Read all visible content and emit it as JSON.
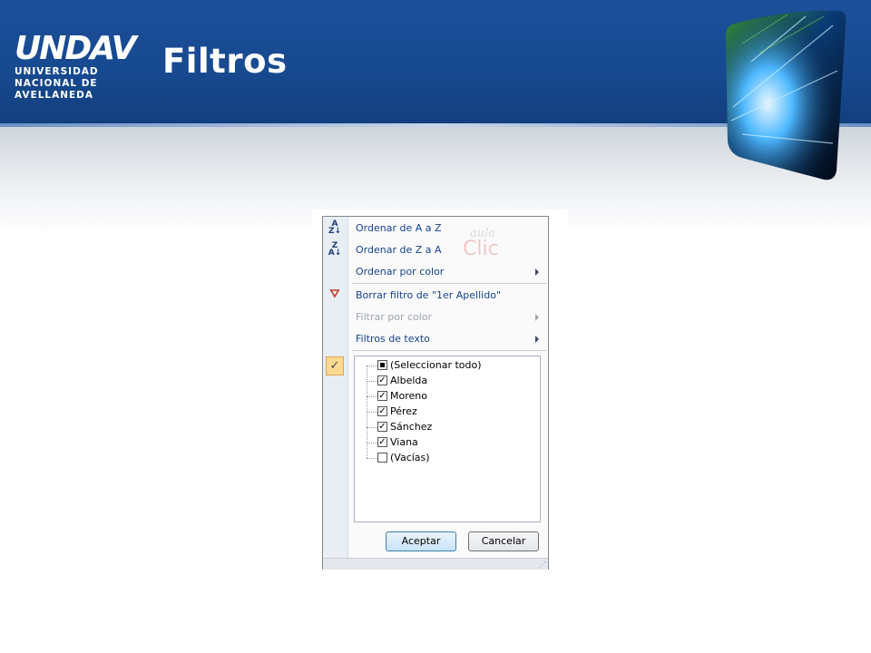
{
  "slide": {
    "title": "Filtros",
    "logo": {
      "mark": "UNDAV",
      "lines": [
        "UNIVERSIDAD",
        "NACIONAL DE",
        "AVELLANEDA"
      ]
    }
  },
  "filter_menu": {
    "items": [
      {
        "label": "Ordenar de A a Z",
        "icon": "sort-az-icon",
        "enabled": true,
        "submenu": false
      },
      {
        "label": "Ordenar de Z a A",
        "icon": "sort-za-icon",
        "enabled": true,
        "submenu": false
      },
      {
        "label": "Ordenar por color",
        "icon": null,
        "enabled": true,
        "submenu": true
      },
      {
        "label": "Borrar filtro de \"1er Apellido\"",
        "icon": "clear-filter-icon",
        "enabled": true,
        "submenu": false
      },
      {
        "label": "Filtrar por color",
        "icon": null,
        "enabled": false,
        "submenu": true
      },
      {
        "label": "Filtros de texto",
        "icon": null,
        "enabled": true,
        "submenu": true
      }
    ],
    "watermark": {
      "line1": "aula",
      "line2": "Clic"
    },
    "values_list": [
      {
        "label": "(Seleccionar todo)",
        "state": "partial"
      },
      {
        "label": "Albelda",
        "state": "checked"
      },
      {
        "label": "Moreno",
        "state": "checked"
      },
      {
        "label": "Pérez",
        "state": "checked"
      },
      {
        "label": "Sánchez",
        "state": "checked"
      },
      {
        "label": "Viana",
        "state": "checked"
      },
      {
        "label": "(Vacías)",
        "state": "unchecked"
      }
    ],
    "ok_label": "Aceptar",
    "cancel_label": "Cancelar",
    "colors": {
      "menu_text": "#15428b",
      "disabled_text": "#9ea4ad",
      "header_blue": "#17498f"
    }
  }
}
